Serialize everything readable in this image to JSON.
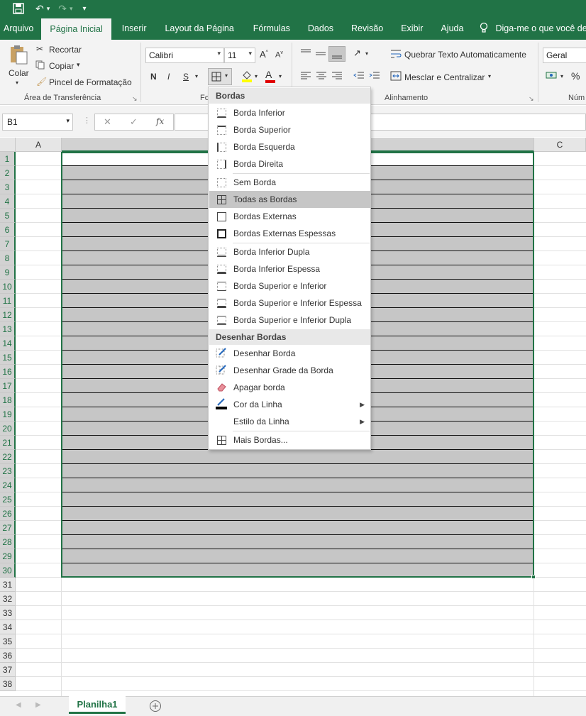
{
  "quick_access": {
    "save_icon": "save-icon",
    "undo_icon": "undo-icon",
    "redo_icon": "redo-icon",
    "customize_icon": "customize-icon"
  },
  "tabs": [
    {
      "label": "Arquivo"
    },
    {
      "label": "Página Inicial"
    },
    {
      "label": "Inserir"
    },
    {
      "label": "Layout da Página"
    },
    {
      "label": "Fórmulas"
    },
    {
      "label": "Dados"
    },
    {
      "label": "Revisão"
    },
    {
      "label": "Exibir"
    },
    {
      "label": "Ajuda"
    }
  ],
  "tell_me": "Diga-me o que você deseja",
  "clipboard": {
    "paste": "Colar",
    "cut": "Recortar",
    "copy": "Copiar",
    "format_painter": "Pincel de Formatação",
    "group_label": "Área de Transferência"
  },
  "font": {
    "name": "Calibri",
    "size": "11",
    "bold": "N",
    "italic": "I",
    "underline": "S",
    "group_label": "Fo"
  },
  "alignment": {
    "wrap_text": "Quebrar Texto Automaticamente",
    "merge_center": "Mesclar e Centralizar",
    "group_label": "Alinhamento"
  },
  "number": {
    "format": "Geral",
    "group_label": "Núm",
    "percent": "%"
  },
  "formula_bar": {
    "name_box": "B1",
    "cancel": "✕",
    "enter": "✓",
    "fx": "fx"
  },
  "columns": [
    "A",
    "C"
  ],
  "rows": [
    "1",
    "2",
    "3",
    "4",
    "5",
    "6",
    "7",
    "8",
    "9",
    "10",
    "11",
    "12",
    "13",
    "14",
    "15",
    "16",
    "17",
    "18",
    "19",
    "20",
    "21",
    "22",
    "23",
    "24",
    "25",
    "26",
    "27",
    "28",
    "29",
    "30",
    "31",
    "32",
    "33",
    "34",
    "35",
    "36",
    "37",
    "38"
  ],
  "sheet": {
    "name": "Planilha1"
  },
  "menu": {
    "header_borders": "Bordas",
    "items": [
      "Borda Inferior",
      "Borda Superior",
      "Borda Esquerda",
      "Borda Direita",
      "Sem Borda",
      "Todas as Bordas",
      "Bordas Externas",
      "Bordas Externas Espessas",
      "Borda Inferior Dupla",
      "Borda Inferior Espessa",
      "Borda Superior e Inferior",
      "Borda Superior e Inferior Espessa",
      "Borda Superior e Inferior Dupla"
    ],
    "header_draw": "Desenhar Bordas",
    "draw_items": [
      "Desenhar Borda",
      "Desenhar Grade da Borda",
      "Apagar borda",
      "Cor da Linha",
      "Estilo da Linha"
    ],
    "more": "Mais Bordas..."
  },
  "colors": {
    "accent": "#217346",
    "selection_fill": "#c6c6c6"
  }
}
